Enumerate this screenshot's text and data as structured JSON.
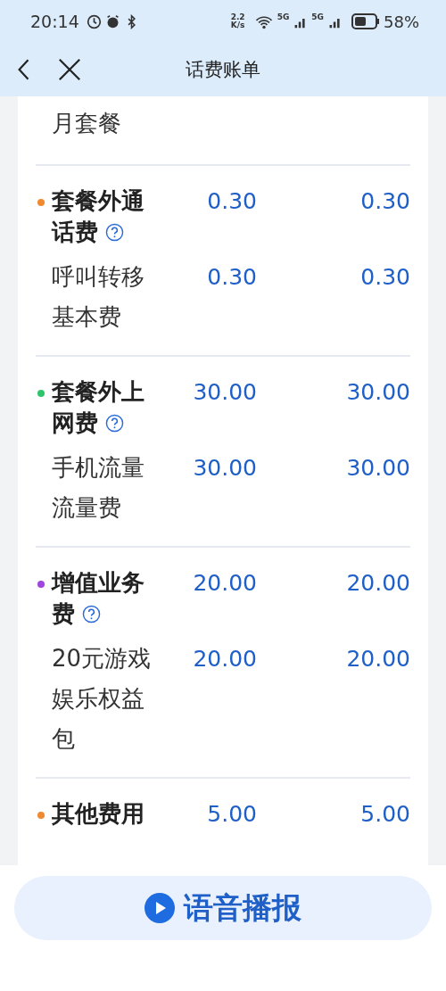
{
  "status_bar": {
    "time": "20:14",
    "speed": "2.2 K/s",
    "network_1": "5G",
    "network_2": "5G",
    "battery": "58%"
  },
  "header": {
    "title": "话费账单"
  },
  "top_fragment": "月套餐",
  "sections": [
    {
      "title": "套餐外通话费",
      "color": "#f08a30",
      "help": true,
      "amount_1": "0.30",
      "amount_2": "0.30",
      "items": [
        {
          "name": "呼叫转移基本费",
          "amount_1": "0.30",
          "amount_2": "0.30"
        }
      ]
    },
    {
      "title": "套餐外上网费",
      "color": "#2fc46a",
      "help": true,
      "amount_1": "30.00",
      "amount_2": "30.00",
      "items": [
        {
          "name": "手机流量流量费",
          "amount_1": "30.00",
          "amount_2": "30.00"
        }
      ]
    },
    {
      "title": "增值业务费",
      "color": "#a045e0",
      "help": true,
      "amount_1": "20.00",
      "amount_2": "20.00",
      "items": [
        {
          "name": "20元游戏娱乐权益包",
          "amount_1": "20.00",
          "amount_2": "20.00"
        }
      ]
    },
    {
      "title": "其他费用",
      "color": "#f08a30",
      "help": false,
      "amount_1": "5.00",
      "amount_2": "5.00"
    }
  ],
  "voice_button": {
    "label": "语音播报"
  }
}
